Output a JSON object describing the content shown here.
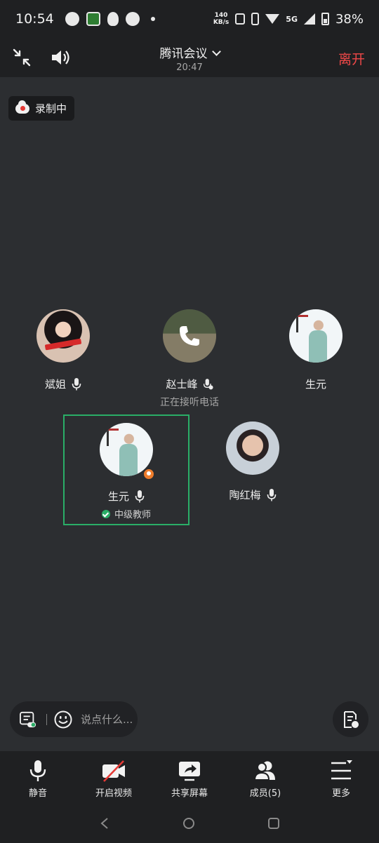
{
  "status_bar": {
    "time": "10:54",
    "speed_value": "140",
    "speed_unit": "KB/s",
    "network": "5G",
    "battery": "38%",
    "icons": [
      "wechat-icon",
      "green-app-icon",
      "qq-icon",
      "panda-app-icon",
      "dot-icon",
      "mute-icon",
      "vibrate-icon",
      "wifi-icon",
      "signal-icon",
      "battery-icon"
    ]
  },
  "header": {
    "title": "腾讯会议",
    "elapsed": "20:47",
    "leave_label": "离开",
    "leave_color": "#f04848"
  },
  "recording": {
    "label": "录制中"
  },
  "participants": [
    {
      "name": "斌姐",
      "status": ""
    },
    {
      "name": "赵士峰",
      "status": "正在接听电话"
    },
    {
      "name": "生元",
      "status": ""
    },
    {
      "name": "生元",
      "role": "中级教师"
    },
    {
      "name": "陶红梅",
      "status": ""
    }
  ],
  "active_speaker_color": "#2aae67",
  "chat": {
    "placeholder": "说点什么..."
  },
  "toolbar": {
    "mute_label": "静音",
    "video_label": "开启视频",
    "share_label": "共享屏幕",
    "members_label": "成员(5)",
    "more_label": "更多"
  }
}
